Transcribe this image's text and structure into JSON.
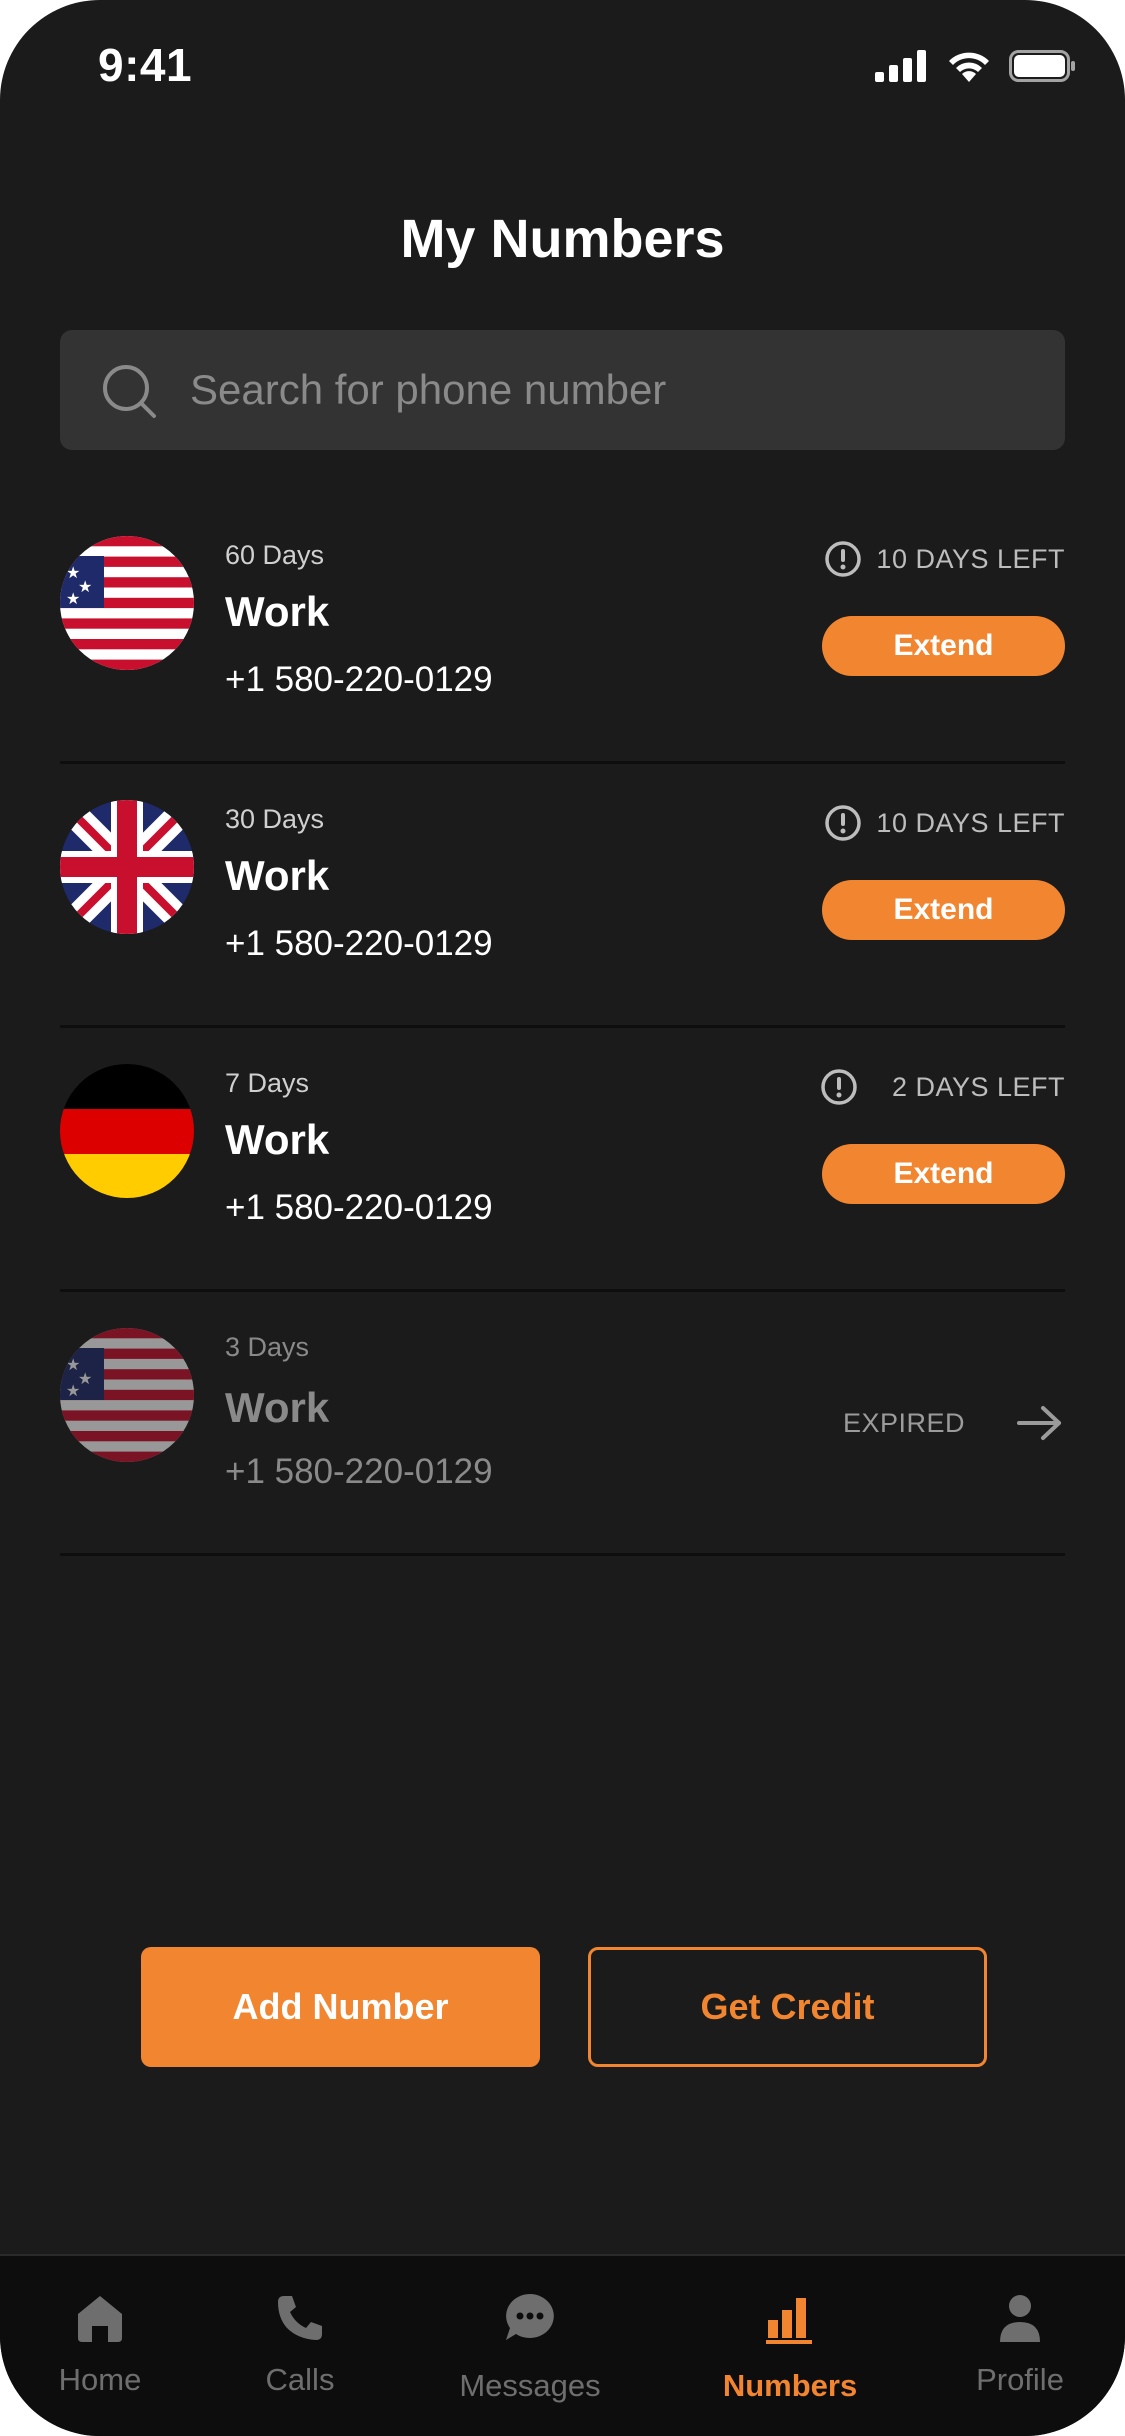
{
  "status_bar": {
    "time": "9:41"
  },
  "header": {
    "title": "My Numbers"
  },
  "search": {
    "placeholder": "Search for phone number"
  },
  "numbers": [
    {
      "flag": "us-flag",
      "duration": "60 Days",
      "label": "Work",
      "phone": "+1 580-220-0129",
      "status": "10 DAYS LEFT",
      "action": "Extend"
    },
    {
      "flag": "uk-flag",
      "duration": "30 Days",
      "label": "Work",
      "phone": "+1 580-220-0129",
      "status": "10 DAYS LEFT",
      "action": "Extend"
    },
    {
      "flag": "germany-flag",
      "duration": "7 Days",
      "label": "Work",
      "phone": "+1 580-220-0129",
      "status": "2 DAYS LEFT",
      "action": "Extend"
    },
    {
      "flag": "us-flag",
      "duration": "3 Days",
      "label": "Work",
      "phone": "+1 580-220-0129",
      "status": "EXPIRED",
      "action": ""
    }
  ],
  "actions": {
    "add_number": "Add Number",
    "get_credit": "Get Credit"
  },
  "tabs": [
    {
      "label": "Home",
      "icon": "home-icon"
    },
    {
      "label": "Calls",
      "icon": "phone-icon"
    },
    {
      "label": "Messages",
      "icon": "chat-icon"
    },
    {
      "label": "Numbers",
      "icon": "bar-chart-icon",
      "active": true
    },
    {
      "label": "Profile",
      "icon": "profile-icon"
    }
  ],
  "colors": {
    "accent": "#f2852f",
    "background": "#1b1b1b",
    "search_bg": "#333333",
    "tabbar_bg": "#0d0d0d"
  }
}
